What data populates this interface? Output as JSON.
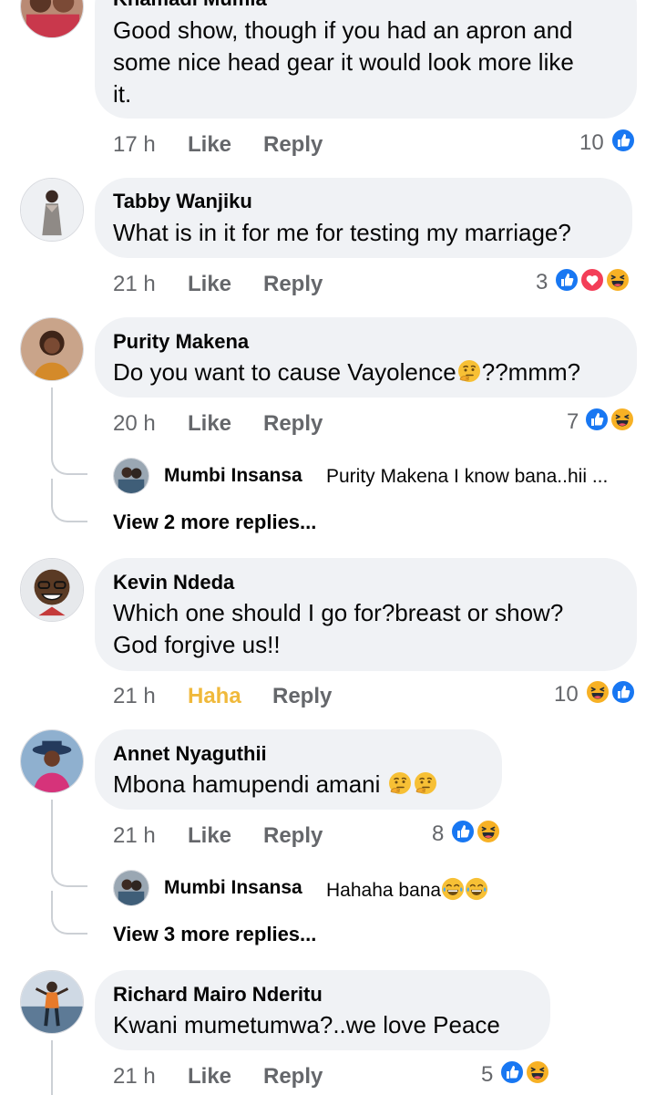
{
  "comments": [
    {
      "name": "Khamadi Mumia",
      "lines": [
        "Good show, though if you had an apron and",
        "some nice head gear it would look more like",
        "it."
      ],
      "time": "17 h",
      "like": "Like",
      "reply": "Reply",
      "count": "10",
      "reactions": [
        "like-reaction-icon"
      ]
    },
    {
      "name": "Tabby Wanjiku",
      "lines": [
        "What is in it for me for testing my marriage?"
      ],
      "time": "21 h",
      "like": "Like",
      "reply": "Reply",
      "count": "3",
      "reactions": [
        "like-reaction-icon",
        "love-reaction-icon",
        "haha-reaction-icon"
      ]
    },
    {
      "name": "Purity Makena",
      "lines": [
        "Do you want to cause Vayolence",
        "??mmm?"
      ],
      "time": "20 h",
      "like": "Like",
      "reply": "Reply",
      "count": "7",
      "reactions": [
        "like-reaction-icon",
        "haha-reaction-icon"
      ],
      "reply_preview": {
        "name": "Mumbi Insansa",
        "text": "Purity Makena I know bana..hii ..."
      },
      "view_more": "View 2 more replies..."
    },
    {
      "name": "Kevin Ndeda",
      "lines": [
        "Which one should I go for?breast or show?",
        "God forgive us!!"
      ],
      "time": "21 h",
      "like": "Haha",
      "reply": "Reply",
      "count": "10",
      "reactions": [
        "haha-reaction-icon",
        "like-reaction-icon"
      ]
    },
    {
      "name": "Annet Nyaguthii",
      "lines": [
        "Mbona hamupendi  amani"
      ],
      "time": "21 h",
      "like": "Like",
      "reply": "Reply",
      "count": "8",
      "reactions": [
        "like-reaction-icon",
        "haha-reaction-icon"
      ],
      "reply_preview": {
        "name": "Mumbi Insansa",
        "text": "Hahaha bana"
      },
      "view_more": "View 3 more replies..."
    },
    {
      "name": "Richard Mairo Nderitu",
      "lines": [
        "Kwani mumetumwa?..we love Peace"
      ],
      "time": "21 h",
      "like": "Like",
      "reply": "Reply",
      "count": "5",
      "reactions": [
        "like-reaction-icon",
        "haha-reaction-icon"
      ]
    }
  ],
  "colors": {
    "bubble": "#f0f2f5",
    "meta": "#65676b",
    "haha_active": "#f0b93b",
    "like_blue": "#1877f2",
    "love_red": "#f33e58",
    "haha_yellow": "#f7b125"
  }
}
